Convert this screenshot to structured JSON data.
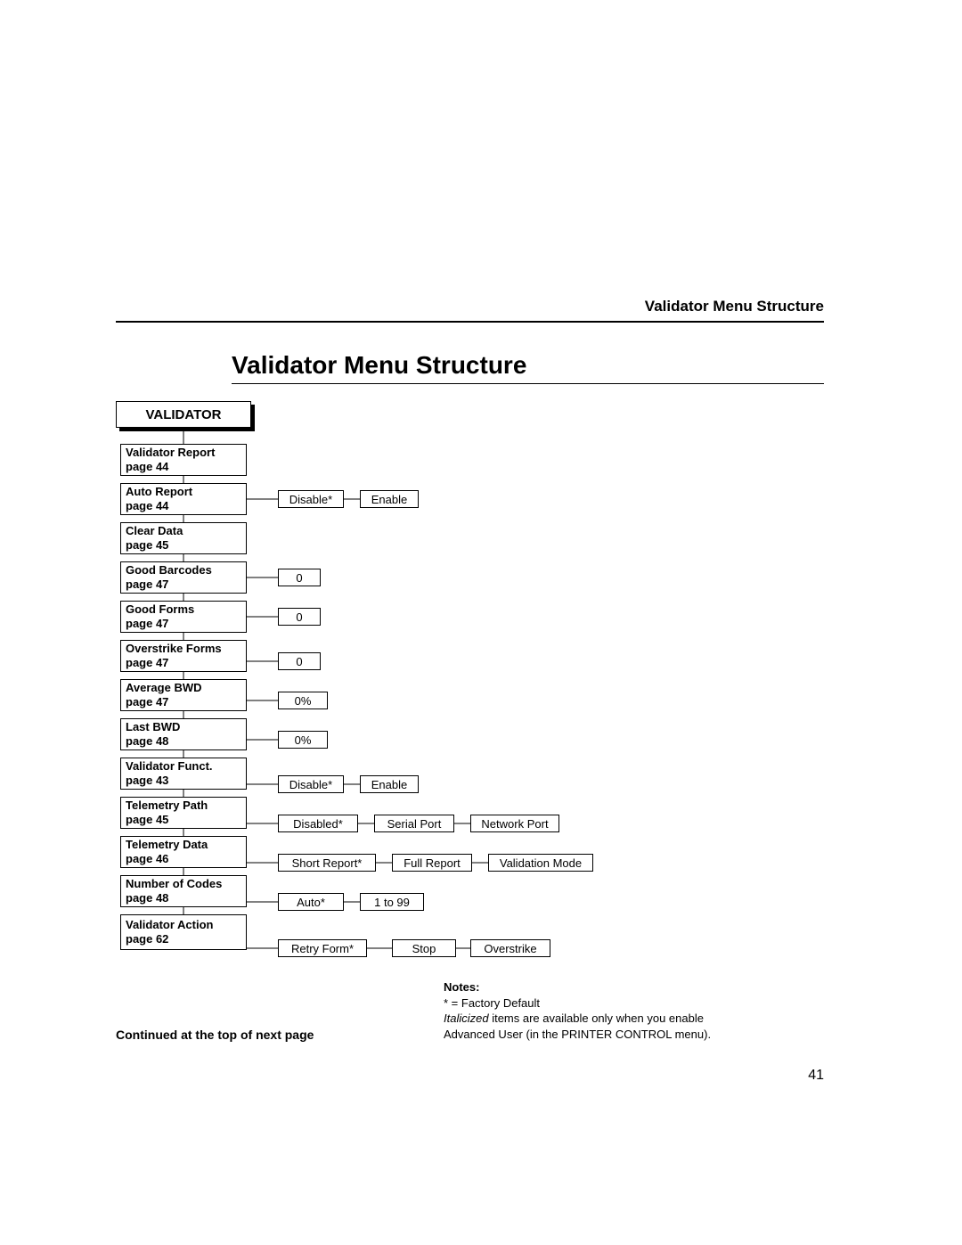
{
  "header": {
    "running_head": "Validator Menu Structure",
    "title": "Validator Menu Structure"
  },
  "root": "VALIDATOR",
  "menu": [
    {
      "name": "Validator Report",
      "page": "page 44",
      "options": []
    },
    {
      "name": "Auto Report",
      "page": "page 44",
      "options": [
        "Disable*",
        "Enable"
      ]
    },
    {
      "name": "Clear Data",
      "page": "page 45",
      "options": []
    },
    {
      "name": "Good Barcodes",
      "page": "page 47",
      "options": [
        "0"
      ]
    },
    {
      "name": "Good Forms",
      "page": "page 47",
      "options": [
        "0"
      ]
    },
    {
      "name": "Overstrike Forms",
      "page": "page 47",
      "options": [
        "0"
      ]
    },
    {
      "name": "Average BWD",
      "page": "page 47",
      "options": [
        "0%"
      ]
    },
    {
      "name": "Last BWD",
      "page": "page 48",
      "options": [
        "0%"
      ]
    },
    {
      "name": "Validator Funct.",
      "page": "page 43",
      "options": [
        "Disable*",
        "Enable"
      ]
    },
    {
      "name": "Telemetry Path",
      "page": "page 45",
      "options": [
        "Disabled*",
        "Serial Port",
        "Network Port"
      ]
    },
    {
      "name": "Telemetry Data",
      "page": "page 46",
      "options": [
        "Short Report*",
        "Full Report",
        "Validation Mode"
      ]
    },
    {
      "name": "Number of Codes",
      "page": "page 48",
      "options": [
        "Auto*",
        "1 to 99"
      ]
    },
    {
      "name": "Validator Action",
      "page": "page 62",
      "options": [
        "Retry Form*",
        "Stop",
        "Overstrike"
      ]
    }
  ],
  "notes": {
    "heading": "Notes:",
    "line1": "* = Factory Default",
    "line2_italic": "Italicized",
    "line2_rest": " items are available only when you enable Advanced User (in the PRINTER CONTROL menu)."
  },
  "continued": "Continued at the top of next page",
  "page_number": "41"
}
